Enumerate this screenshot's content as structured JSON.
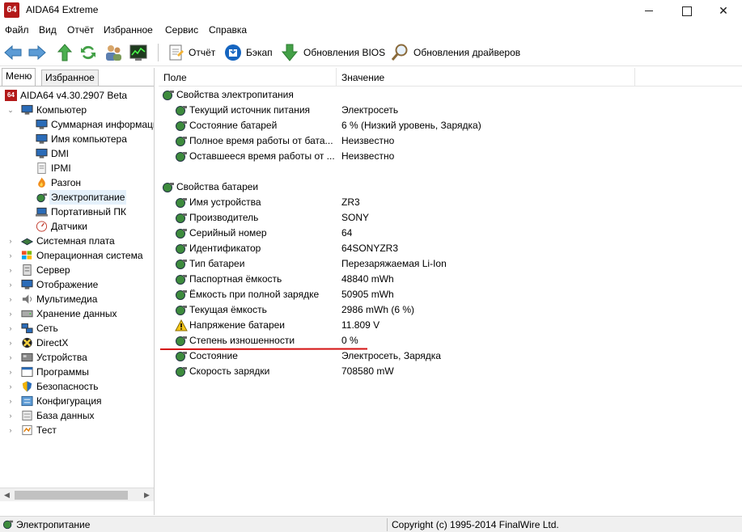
{
  "window": {
    "app_icon_text": "64",
    "title": "AIDA64 Extreme"
  },
  "menu": [
    "Файл",
    "Вид",
    "Отчёт",
    "Избранное",
    "Сервис",
    "Справка"
  ],
  "toolbar": {
    "report": "Отчёт",
    "backup": "Бэкап",
    "bios_updates": "Обновления BIOS",
    "driver_updates": "Обновления драйверов"
  },
  "tabs": {
    "menu": "Меню",
    "favorites": "Избранное"
  },
  "tree": {
    "root": "AIDA64 v4.30.2907 Beta",
    "computer": "Компьютер",
    "computer_children": [
      "Суммарная информация",
      "Имя компьютера",
      "DMI",
      "IPMI",
      "Разгон",
      "Электропитание",
      "Портативный ПК",
      "Датчики"
    ],
    "categories": [
      "Системная плата",
      "Операционная система",
      "Сервер",
      "Отображение",
      "Мультимедиа",
      "Хранение данных",
      "Сеть",
      "DirectX",
      "Устройства",
      "Программы",
      "Безопасность",
      "Конфигурация",
      "База данных",
      "Тест"
    ]
  },
  "columns": {
    "field": "Поле",
    "value": "Значение"
  },
  "power_section": {
    "title": "Свойства электропитания",
    "rows": [
      {
        "field": "Текущий источник питания",
        "value": "Электросеть"
      },
      {
        "field": "Состояние батарей",
        "value": "6 % (Низкий уровень, Зарядка)"
      },
      {
        "field": "Полное время работы от бата...",
        "value": "Неизвестно"
      },
      {
        "field": "Оставшееся время работы от ...",
        "value": "Неизвестно"
      }
    ]
  },
  "battery_section": {
    "title": "Свойства батареи",
    "rows": [
      {
        "field": "Имя устройства",
        "value": "ZR3"
      },
      {
        "field": "Производитель",
        "value": "SONY"
      },
      {
        "field": "Серийный номер",
        "value": "64"
      },
      {
        "field": "Идентификатор",
        "value": "64SONYZR3"
      },
      {
        "field": "Тип батареи",
        "value": "Перезаряжаемая Li-Ion"
      },
      {
        "field": "Паспортная ёмкость",
        "value": "48840 mWh"
      },
      {
        "field": "Ёмкость при полной зарядке",
        "value": "50905 mWh"
      },
      {
        "field": "Текущая ёмкость",
        "value": "2986 mWh  (6 %)"
      },
      {
        "field": "Напряжение батареи",
        "value": "11.809 V"
      },
      {
        "field": "Степень изношенности",
        "value": "0 %"
      },
      {
        "field": "Состояние",
        "value": "Электросеть, Зарядка"
      },
      {
        "field": "Скорость зарядки",
        "value": "708580 mW"
      }
    ]
  },
  "status": {
    "left": "Электропитание",
    "right": "Copyright (c) 1995-2014 FinalWire Ltd."
  },
  "colors": {
    "accent_red": "#b31919",
    "selection": "#e5f1fb",
    "annotation_red": "#d41111"
  }
}
